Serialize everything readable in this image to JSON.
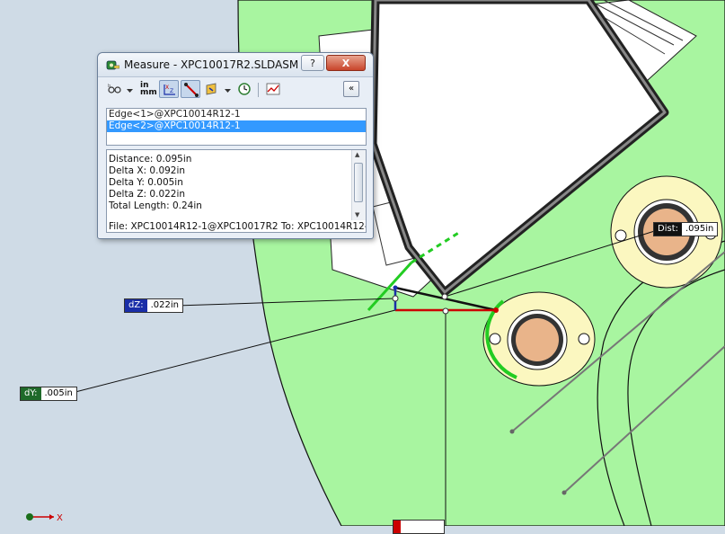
{
  "dialog": {
    "title": "Measure - XPC10017R2.SLDASM",
    "help_label": "?",
    "close_label": "X",
    "toolbar": {
      "units_top": "in",
      "units_bottom": "mm",
      "collapse_glyph": "«"
    },
    "selections": [
      "Edge<1>@XPC10014R12-1",
      "Edge<2>@XPC10014R12-1"
    ],
    "results": [
      "Distance: 0.095in",
      "Delta X: 0.092in",
      "Delta Y: 0.005in",
      "Delta Z: 0.022in",
      "Total Length: 0.24in"
    ],
    "file_line": "File: XPC10014R12-1@XPC10017R2 To: XPC10014R12-..."
  },
  "callouts": {
    "dz": {
      "key": "dZ:",
      "value": ".022in"
    },
    "dy": {
      "key": "dY:",
      "value": ".005in"
    },
    "dist": {
      "key": "Dist:",
      "value": ".095in"
    },
    "bottom": {
      "key": "",
      "value": ""
    }
  },
  "triad": {
    "x_label": "X"
  },
  "colors": {
    "background": "#cfdbe6",
    "part_green": "#a8f5a0",
    "hub_yellow": "#fbf7c0",
    "hub_copper": "#e9b48a",
    "selection_blue": "#3399ff",
    "edge_green": "#22cc22",
    "edge_red": "#cc0000",
    "delta_blue": "#1a2ea8"
  }
}
